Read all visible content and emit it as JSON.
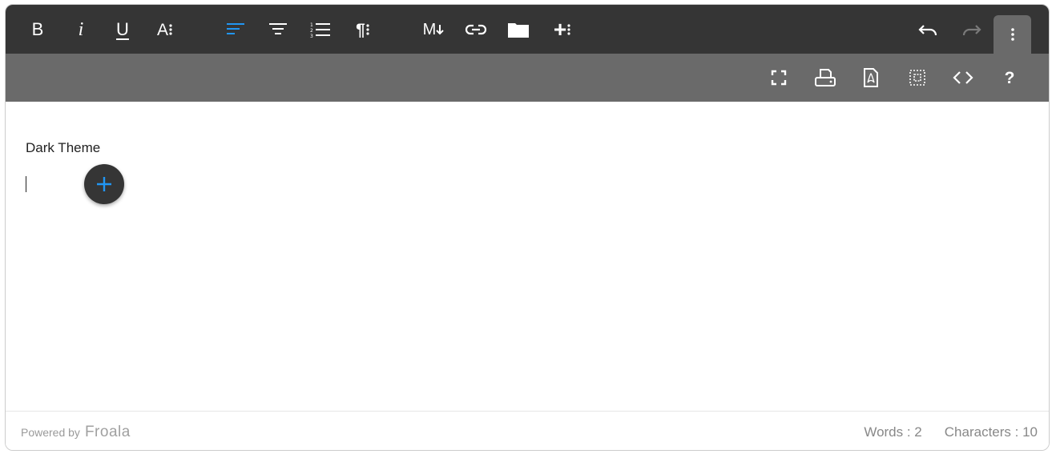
{
  "toolbar": {
    "bold": {
      "label": "B",
      "icon": "bold-icon"
    },
    "italic": {
      "label": "i",
      "icon": "italic-icon"
    },
    "underline": {
      "label": "U",
      "icon": "underline-icon"
    },
    "text_more": {
      "label": "A",
      "icon": "text-more-icon"
    },
    "paragraph_format": {
      "icon": "paragraph-format-icon"
    },
    "align_center": {
      "icon": "align-center-icon"
    },
    "ordered_list": {
      "icon": "ordered-list-icon"
    },
    "paragraph_more": {
      "label": "¶",
      "icon": "pilcrow-icon"
    },
    "markdown": {
      "label": "M",
      "icon": "markdown-icon"
    },
    "insert_link": {
      "icon": "link-icon"
    },
    "insert_file": {
      "icon": "folder-icon"
    },
    "insert_more": {
      "label": "+",
      "icon": "plus-more-icon"
    },
    "undo": {
      "icon": "undo-icon"
    },
    "redo": {
      "icon": "redo-icon"
    },
    "more": {
      "icon": "vertical-ellipsis-icon"
    }
  },
  "toolbar_more": {
    "fullscreen": {
      "icon": "fullscreen-icon"
    },
    "print": {
      "icon": "print-icon"
    },
    "pdf": {
      "icon": "pdf-icon"
    },
    "select_all": {
      "icon": "select-all-icon"
    },
    "html": {
      "icon": "code-view-icon"
    },
    "help": {
      "label": "?",
      "icon": "help-icon"
    }
  },
  "content": {
    "paragraph": "Dark Theme"
  },
  "quick_insert": {
    "icon": "plus-icon"
  },
  "footer": {
    "powered_label": "Powered by",
    "brand": "Froala",
    "words": "Words : 2",
    "characters": "Characters : 10"
  },
  "colors": {
    "toolbar": "#353535",
    "toolbar_more": "#6a6a6a",
    "accent": "#2196f3",
    "disabled": "#7a7a7a"
  }
}
